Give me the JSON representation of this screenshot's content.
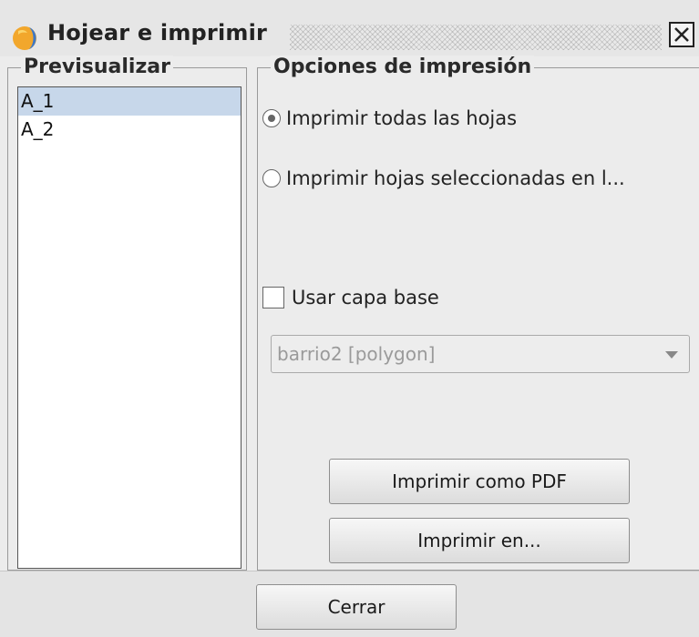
{
  "window": {
    "title": "Hojear e imprimir",
    "icon": "app-icon",
    "close_icon": "close-icon"
  },
  "preview": {
    "legend": "Previsualizar",
    "items": [
      {
        "label": "A_1",
        "selected": true
      },
      {
        "label": "A_2",
        "selected": false
      }
    ]
  },
  "options": {
    "legend": "Opciones de impresión",
    "radio_all": {
      "label": "Imprimir todas las hojas",
      "checked": true
    },
    "radio_selected": {
      "label": "Imprimir hojas seleccionadas en l...",
      "checked": false
    },
    "base_layer": {
      "label": "Usar capa base",
      "checked": false
    },
    "layer_select": {
      "value": "barrio2 [polygon]",
      "enabled": false
    },
    "print_pdf_label": "Imprimir como PDF",
    "print_to_label": "Imprimir en..."
  },
  "footer": {
    "close_label": "Cerrar"
  },
  "colors": {
    "selection": "#c7d7ea",
    "background": "#ececec"
  }
}
